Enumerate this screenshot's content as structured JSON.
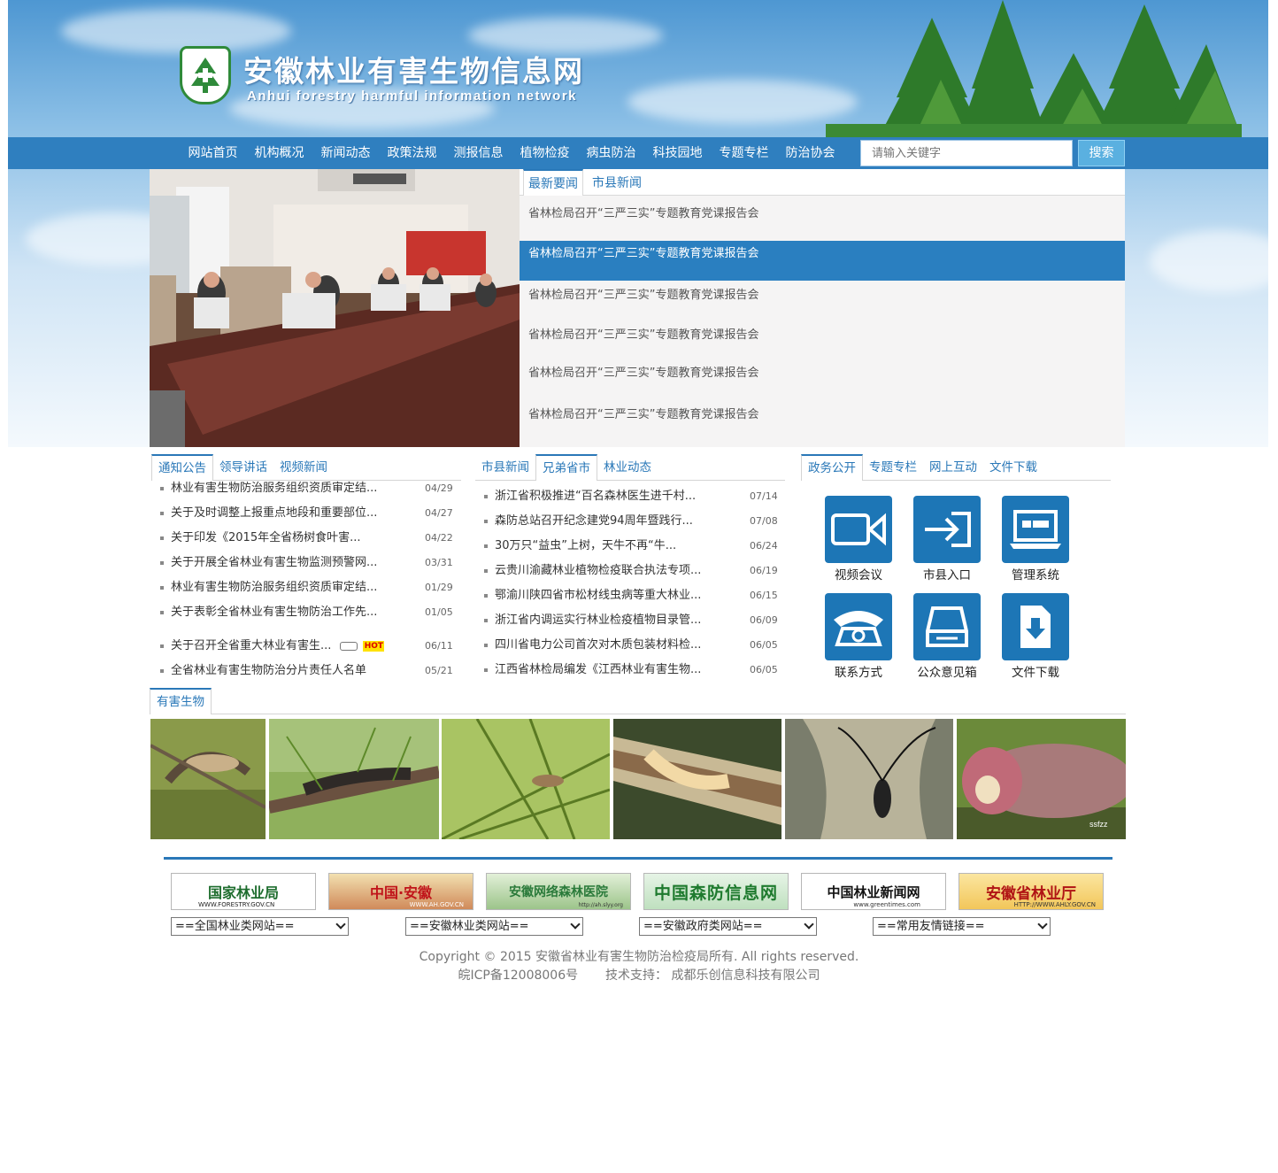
{
  "header": {
    "title": "安徽林业有害生物信息网",
    "subtitle": "Anhui forestry harmful information network",
    "logo_alt": "安徽林业有害生物信息网 徽标"
  },
  "nav": {
    "items": [
      "网站首页",
      "机构概况",
      "新闻动态",
      "政策法规",
      "测报信息",
      "植物检疫",
      "病虫防治",
      "科技园地",
      "专题专栏",
      "防治协会"
    ],
    "search_placeholder": "请输入关键字",
    "search_button": "搜索"
  },
  "top_news": {
    "tabs": [
      "最新要闻",
      "市县新闻"
    ],
    "active_tab": 0,
    "items": [
      "省林检局召开“三严三实”专题教育党课报告会",
      "省林检局召开“三严三实”专题教育党课报告会",
      "省林检局召开“三严三实”专题教育党课报告会",
      "省林检局召开“三严三实”专题教育党课报告会",
      "省林检局召开“三严三实”专题教育党课报告会",
      "省林检局召开“三严三实”专题教育党课报告会"
    ],
    "selected_index": 1
  },
  "notice_panel": {
    "tabs": [
      "通知公告",
      "领导讲话",
      "视频新闻"
    ],
    "items": [
      {
        "title": "林业有害生物防治服务组织资质审定结...",
        "date": "04/29"
      },
      {
        "title": "关于及时调整上报重点地段和重要部位...",
        "date": "04/27"
      },
      {
        "title": "关于印发《2015年全省杨树食叶害...",
        "date": "04/22"
      },
      {
        "title": "关于开展全省林业有害生物监测预警网...",
        "date": "03/31"
      },
      {
        "title": "林业有害生物防治服务组织资质审定结...",
        "date": "01/29"
      },
      {
        "title": "关于表彰全省林业有害生物防治工作先...",
        "date": "01/05"
      },
      {
        "title": "关于召开全省重大林业有害生...",
        "date": "06/11",
        "hot": "HOT"
      },
      {
        "title": "全省林业有害生物防治分片责任人名单",
        "date": "05/21"
      }
    ]
  },
  "news_panel": {
    "tabs": [
      "市县新闻",
      "兄弟省市",
      "林业动态"
    ],
    "items": [
      {
        "title": "浙江省积极推进“百名森林医生进千村...",
        "date": "07/14"
      },
      {
        "title": "森防总站召开纪念建党94周年暨践行...",
        "date": "07/08"
      },
      {
        "title": "30万只“益虫”上树，天牛不再“牛...",
        "date": "06/24"
      },
      {
        "title": "云贵川渝藏林业植物检疫联合执法专项...",
        "date": "06/19"
      },
      {
        "title": "鄂渝川陕四省市松材线虫病等重大林业...",
        "date": "06/15"
      },
      {
        "title": "浙江省内调运实行林业检疫植物目录管...",
        "date": "06/09"
      },
      {
        "title": "四川省电力公司首次对木质包装材料检...",
        "date": "06/05"
      },
      {
        "title": "江西省林检局编发《江西林业有害生物...",
        "date": "06/05"
      }
    ]
  },
  "gov_panel": {
    "tabs": [
      "政务公开",
      "专题专栏",
      "网上互动",
      "文件下载"
    ],
    "icons": [
      {
        "label": "视频会议",
        "icon": "video-camera-icon"
      },
      {
        "label": "市县入口",
        "icon": "enter-arrow-icon"
      },
      {
        "label": "管理系统",
        "icon": "laptop-icon"
      },
      {
        "label": "联系方式",
        "icon": "telephone-icon"
      },
      {
        "label": "公众意见箱",
        "icon": "inbox-tray-icon"
      },
      {
        "label": "文件下载",
        "icon": "file-download-icon"
      }
    ]
  },
  "pests": {
    "tab": "有害生物",
    "watermark": "ssfzz"
  },
  "friend_links": {
    "logos": [
      {
        "text": "国家林业局",
        "sub": "WWW.FORESTRY.GOV.CN"
      },
      {
        "text": "中国·安徽",
        "sub": "WWW.AH.GOV.CN"
      },
      {
        "text": "安徽网络森林医院",
        "sub": "http://ah.slyy.org"
      },
      {
        "text": "中国森防信息网",
        "sub": ""
      },
      {
        "text": "中国林业新闻网",
        "sub": "www.greentimes.com"
      },
      {
        "text": "安徽省林业厅",
        "sub": "HTTP://WWW.AHLY.GOV.CN"
      }
    ],
    "selects": [
      "==全国林业类网站==",
      "==安徽林业类网站==",
      "==安徽政府类网站==",
      "==常用友情链接=="
    ]
  },
  "footer": {
    "copyright": "Copyright © 2015 安徽省林业有害生物防治检疫局所有. All rights reserved.",
    "icp": "皖ICP备12008006号",
    "support_label": "技术支持：",
    "support_company": "成都乐创信息科技有限公司"
  },
  "colors": {
    "primary": "#2f7fbf",
    "link": "#2a78b8",
    "icon_bg": "#1d76b6",
    "selected_row": "#2a7fc0"
  }
}
